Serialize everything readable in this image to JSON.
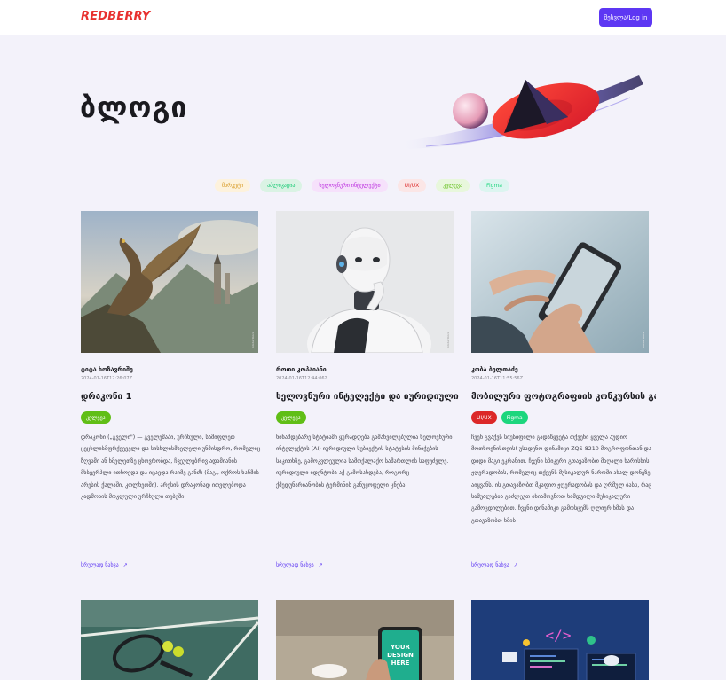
{
  "header": {
    "logo": "REDBERRY",
    "login_label": "შესვლა/Log in"
  },
  "hero": {
    "title": "ბლოგი"
  },
  "filters": [
    {
      "label": "მარკეტი",
      "bg": "#fdf2dc",
      "fg": "#d6961c"
    },
    {
      "label": "აპლიკაცია",
      "bg": "#daf3e4",
      "fg": "#15c972"
    },
    {
      "label": "ხელოვნური ინტელექტი",
      "bg": "#f6e1fb",
      "fg": "#b71fdd"
    },
    {
      "label": "UI/UX",
      "bg": "#fbe6e6",
      "fg": "#dc2828"
    },
    {
      "label": "კვლევა",
      "bg": "#e8f7dc",
      "fg": "#60be16"
    },
    {
      "label": "Figma",
      "bg": "#dcf5f0",
      "fg": "#1cd67d"
    }
  ],
  "posts": [
    {
      "author": "ტიტა ხოზავრიშე",
      "date": "2024-01-16T12:26:07Z",
      "title": "დრაკონი 1",
      "tags": [
        {
          "label": "კვლევა",
          "color": "#60be16"
        }
      ],
      "description": "დრაკონი („გველი\") — გველეშაპი, ურჩხული, სამიფლეთ ცეცხლისმფრქვეველი და სისხლისმსელელი უნმისდრო, რომელიც ზღვამი ან ხმელეთზე ცხოვრობდა, ჩვეულებრივ ადამიანის მხსვერპლი ითხოვდა და იცავდა რაიმე განძს (მაგ., ოქროს ხანმის არესის ქალაში, კოლხეთში). არესის დრაკონად ითვლებოდა კადმოსის მოკლული ურჩხული თებეში.",
      "more_label": "სრულად ნახვა"
    },
    {
      "author": "როთი კოპაიანი",
      "date": "2024-01-16T12:44:06Z",
      "title": "ხელოვნური ინტელექტი და იურიდიული",
      "tags": [
        {
          "label": "კვლევა",
          "color": "#60be16"
        }
      ],
      "description": "ნინამდებარე სტატიაში ყურადღება გამახვილებულია ხელოვნური ინტელექტის (AI) იურიდიული სუბიექტის სტატუსის მინიჭების საკითხზე, გამოკვლეულია სამოქალაქო სამართლის საფუძვლე. იურიდიული იდენტობა აქ გამოსახდება, როგორც ქმედუნარიანობის ტერმინის განუყოფელი ცნება.",
      "more_label": "სრულად ნახვა"
    },
    {
      "author": "კობა ბელთაძე",
      "date": "2024-01-16T11:55:56Z",
      "title": "მობილური ფოტოგრაფიის კონკურსის გამ",
      "tags": [
        {
          "label": "UI/UX",
          "color": "#dc2828"
        },
        {
          "label": "Figma",
          "color": "#1cd67d"
        }
      ],
      "description": "ჩვენ გვაქვს სიუსიფილი გადაწყვეტა თქვენი ყველა აუდიო მოთხოვნისთვის! უსადენო დინამიკი ZQS-8210 მოგროფონთან და დიდი მაგი ეკრანით. ჩვენი სპიკერი გთავაზობთ მაღალი ხარისხის ჟღერადობას, რომელიც თქვენს მუსიკალურ ნაროში ახალ დონეზე აიყვანს. ის გთავაზობთ მკაფიო ჟღერადობას და ღრმულ ბასს, რაც საშუალებას გაძლევთ იხიამოვნოთ ხამდვილი მუსიკალური გამოცდილებით. ჩვენი დინამიკი გამოსცემს ღლიერ ხმას და გთავაზობთ ხმის",
      "more_label": "სრულად ნახვა"
    }
  ],
  "second_row_images": [
    {
      "name": "tennis-image"
    },
    {
      "name": "phone-mockup-image",
      "text": "YOUR DESIGN HERE"
    },
    {
      "name": "code-illustration-image"
    }
  ]
}
